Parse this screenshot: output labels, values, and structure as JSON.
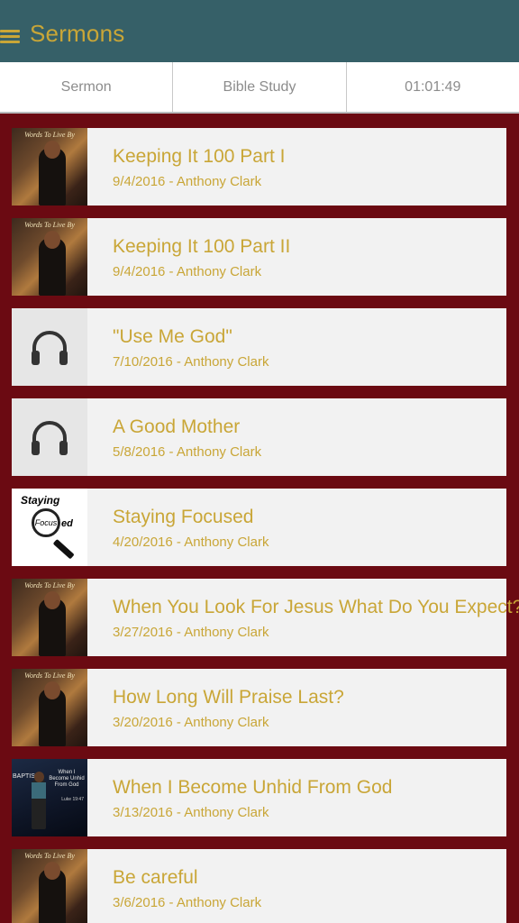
{
  "header": {
    "title": "Sermons",
    "menu_icon": "hamburger-menu-icon"
  },
  "tabs": [
    {
      "label": "Sermon"
    },
    {
      "label": "Bible Study"
    },
    {
      "label": "01:01:49"
    }
  ],
  "colors": {
    "header_bg": "#366068",
    "accent": "#c9a637",
    "list_bg": "#6b0a12",
    "card_bg": "#f2f2f2"
  },
  "sermons": [
    {
      "title": "Keeping It 100 Part I",
      "subtitle": "9/4/2016 - Anthony Clark",
      "thumb": "words-to-live-by",
      "thumb_caption": "Words To Live By"
    },
    {
      "title": "Keeping It 100 Part II",
      "subtitle": "9/4/2016 - Anthony Clark",
      "thumb": "words-to-live-by",
      "thumb_caption": "Words To Live By"
    },
    {
      "title": "\"Use Me God\"",
      "subtitle": "7/10/2016 - Anthony Clark",
      "thumb": "headphones-icon"
    },
    {
      "title": "A Good Mother",
      "subtitle": "5/8/2016 - Anthony Clark",
      "thumb": "headphones-icon"
    },
    {
      "title": "Staying Focused",
      "subtitle": "4/20/2016 - Anthony Clark",
      "thumb": "staying-focused",
      "thumb_caption": "Staying",
      "thumb_lens": "Focus",
      "thumb_suffix": "ed"
    },
    {
      "title": "When You Look For Jesus What Do You Expect?",
      "subtitle": "3/27/2016 - Anthony Clark",
      "thumb": "words-to-live-by",
      "thumb_caption": "Words To Live By"
    },
    {
      "title": "How Long Will Praise Last?",
      "subtitle": "3/20/2016 - Anthony Clark",
      "thumb": "words-to-live-by",
      "thumb_caption": "Words To Live By"
    },
    {
      "title": "When I Become Unhid From God",
      "subtitle": "3/13/2016 - Anthony Clark",
      "thumb": "stage-photo",
      "thumb_caption": "When I Become Unhid From God",
      "thumb_side": "BAPTIS",
      "thumb_ref": "Luke 19:47"
    },
    {
      "title": "Be careful",
      "subtitle": "3/6/2016 - Anthony Clark",
      "thumb": "words-to-live-by",
      "thumb_caption": "Words To Live By"
    }
  ]
}
